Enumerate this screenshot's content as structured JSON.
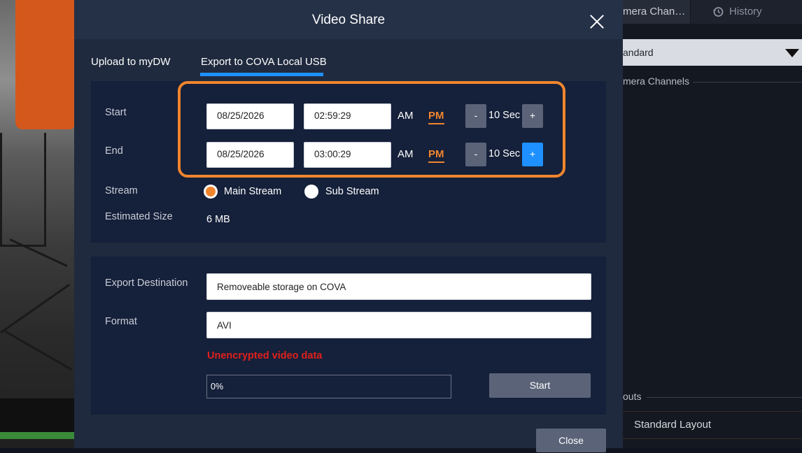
{
  "background": {
    "right_panel": {
      "camera_tab_label": "mera Chan…",
      "history_tab_label": "History",
      "layout_select_value": "andard",
      "camera_channels_label": "mera Channels",
      "layouts_label": "outs",
      "layout_item": "Standard Layout"
    }
  },
  "modal": {
    "title": "Video Share",
    "tabs": [
      {
        "label": "Upload to myDW",
        "active": false
      },
      {
        "label": "Export to COVA Local USB",
        "active": true
      }
    ],
    "start": {
      "label": "Start",
      "date": "08/25/2026",
      "time": "02:59:29",
      "am": "AM",
      "pm": "PM",
      "selected": "PM",
      "minus": "-",
      "step": "10 Sec",
      "plus": "+"
    },
    "end": {
      "label": "End",
      "date": "08/25/2026",
      "time": "03:00:29",
      "am": "AM",
      "pm": "PM",
      "selected": "PM",
      "minus": "-",
      "step": "10 Sec",
      "plus": "+"
    },
    "stream": {
      "label": "Stream",
      "options": [
        "Main Stream",
        "Sub Stream"
      ],
      "selected": "Main Stream"
    },
    "estimated_size": {
      "label": "Estimated Size",
      "value": "6 MB"
    },
    "export_destination": {
      "label": "Export Destination",
      "value": "Removeable storage on COVA"
    },
    "format": {
      "label": "Format",
      "value": "AVI"
    },
    "warning": "Unencrypted video data",
    "progress": {
      "text": "0%",
      "value": 0
    },
    "start_button": "Start",
    "close_button": "Close"
  },
  "colors": {
    "accent_orange": "#f0852d",
    "accent_blue": "#1e90ff",
    "warning_red": "#e0201c",
    "modal_bg": "#1f2a3e",
    "section_bg": "#15203a"
  },
  "icons": [
    "close-icon",
    "history-icon",
    "chevron-down-icon"
  ]
}
